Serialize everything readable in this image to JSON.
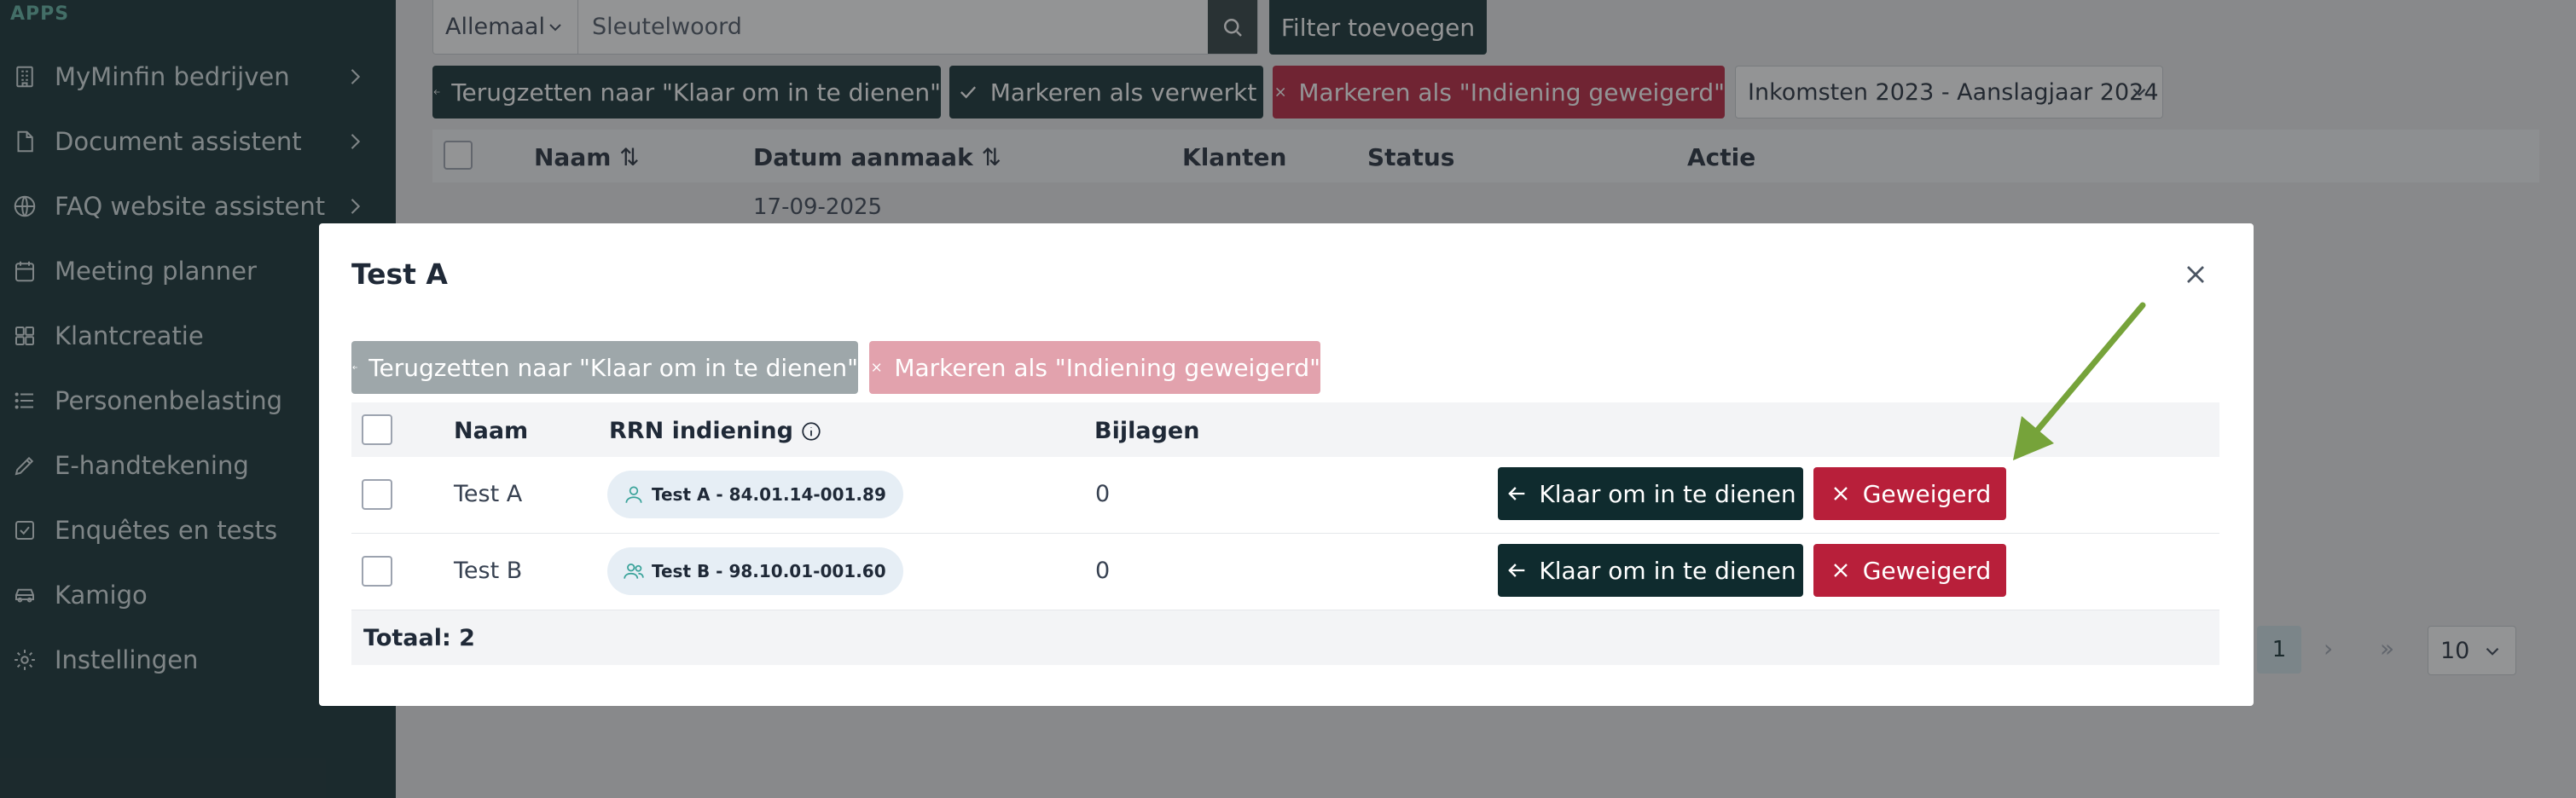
{
  "sidebar": {
    "section_label": "APPS",
    "items": [
      {
        "label": "MyMinfin bedrijven",
        "icon": "building-icon",
        "has_chevron": true
      },
      {
        "label": "Document assistent",
        "icon": "document-icon",
        "has_chevron": true
      },
      {
        "label": "FAQ website assistent",
        "icon": "globe-icon",
        "has_chevron": true
      },
      {
        "label": "Meeting planner",
        "icon": "calendar-icon",
        "has_chevron": false
      },
      {
        "label": "Klantcreatie",
        "icon": "grid-icon",
        "has_chevron": false
      },
      {
        "label": "Personenbelasting",
        "icon": "list-icon",
        "has_chevron": false
      },
      {
        "label": "E-handtekening",
        "icon": "pen-icon",
        "has_chevron": false
      },
      {
        "label": "Enquêtes en tests",
        "icon": "checkbox-icon",
        "has_chevron": false
      },
      {
        "label": "Kamigo",
        "icon": "car-icon",
        "has_chevron": false
      },
      {
        "label": "Instellingen",
        "icon": "gear-icon",
        "has_chevron": false
      }
    ]
  },
  "toolbar": {
    "filter_type": "Allemaal",
    "search_placeholder": "Sleutelwoord",
    "add_filter_label": "Filter toevoegen",
    "reset_label": "Terugzetten naar \"Klaar om in te dienen\"",
    "mark_processed_label": "Markeren als verwerkt",
    "mark_refused_label": "Markeren als \"Indiening geweigerd\"",
    "period_select": "Inkomsten 2023 - Aanslagjaar 2024"
  },
  "background_table": {
    "headers": [
      "Naam",
      "Datum aanmaak",
      "Klanten",
      "Status",
      "Actie"
    ],
    "first_row_date": "17-09-2025"
  },
  "pagination": {
    "current_page": "1",
    "page_size": "10"
  },
  "modal": {
    "title": "Test A",
    "reset_label": "Terugzetten naar \"Klaar om in te dienen\"",
    "refuse_label": "Markeren als \"Indiening geweigerd\"",
    "headers": {
      "name": "Naam",
      "rrn": "RRN indiening",
      "attachments": "Bijlagen"
    },
    "rows": [
      {
        "name": "Test A",
        "rrn": "Test A - 84.01.14-001.89",
        "rrn_icon": "user-icon",
        "attachments": "0",
        "ready_label": "Klaar om in te dienen",
        "refused_label": "Geweigerd"
      },
      {
        "name": "Test B",
        "rrn": "Test B - 98.10.01-001.60",
        "rrn_icon": "users-icon",
        "attachments": "0",
        "ready_label": "Klaar om in te dienen",
        "refused_label": "Geweigerd"
      }
    ],
    "total_label": "Totaal: 2"
  },
  "colors": {
    "sidebar_bg": "#0f2b2e",
    "primary_dark": "#0f2b2e",
    "danger": "#b81f3a",
    "annotation_arrow": "#76a33a"
  }
}
